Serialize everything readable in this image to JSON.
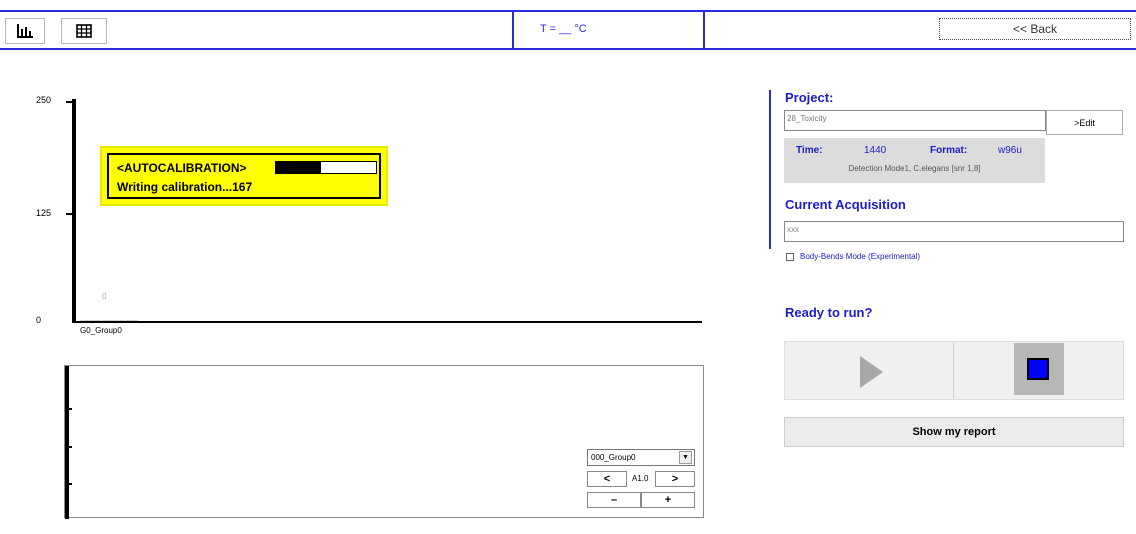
{
  "topbar": {
    "chart_icon": "bar-chart-icon",
    "grid_icon": "grid-icon",
    "temperature": "T = __ °C",
    "back_label": "<< Back"
  },
  "chart": {
    "y_ticks": [
      "250",
      "125",
      "0"
    ],
    "bar_value_label": "0",
    "category_label": "G0_Group0"
  },
  "autocalibration": {
    "title": "<AUTOCALIBRATION>",
    "status": "Writing calibration...167",
    "progress": 0.45
  },
  "lower_panel": {
    "group_select_value": "000_Group0",
    "prev_label": "<",
    "next_label": ">",
    "well_label": "A1.0",
    "minus_label": "–",
    "plus_label": "+"
  },
  "project": {
    "title": "Project:",
    "name": "28_Toxicity",
    "edit_label": ">Edit",
    "time_key": "Time:",
    "time_value": "1440",
    "format_key": "Format:",
    "format_value": "w96u",
    "mode_line": "Detection Mode1, C.elegans [snr 1,8]"
  },
  "acquisition": {
    "title": "Current Acquisition",
    "value": "xxx",
    "bodybends_label": "Body-Bends Mode (Experimental)"
  },
  "run": {
    "ready_label": "Ready to run?",
    "report_label": "Show my report"
  },
  "colors": {
    "accent_blue": "#2b2bd8",
    "warning_yellow": "#ffff00",
    "stop_blue": "#0000ff"
  }
}
